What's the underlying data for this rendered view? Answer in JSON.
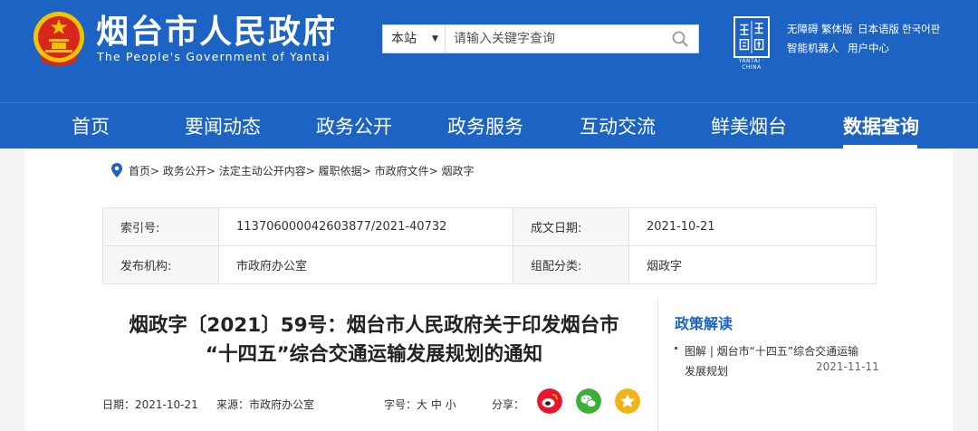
{
  "header": {
    "title": "烟台市人民政府",
    "subtitle": "The People's Government of Yantai",
    "seal_caption": "YANTAI · CHINA",
    "search": {
      "scope": "本站",
      "placeholder": "请输入关键字查询"
    },
    "utility_links": [
      "无障碍",
      "繁体版",
      "日本语版",
      "한국어판",
      "智能机器人",
      "用户中心"
    ]
  },
  "nav": {
    "items": [
      "首页",
      "要闻动态",
      "政务公开",
      "政务服务",
      "互动交流",
      "鲜美烟台",
      "数据查询"
    ],
    "active_index": 6
  },
  "breadcrumb": {
    "items": [
      "首页",
      "政务公开",
      "法定主动公开内容",
      "履职依据",
      "市政府文件",
      "烟政字"
    ],
    "separator": "> "
  },
  "meta": {
    "index_no_label": "索引号:",
    "index_no": "113706000042603877/2021-40732",
    "date_label": "成文日期:",
    "date": "2021-10-21",
    "publisher_label": "发布机构:",
    "publisher": "市政府办公室",
    "category_label": "组配分类:",
    "category": "烟政字"
  },
  "article": {
    "title_line1": "烟政字〔2021〕59号：烟台市人民政府关于印发烟台市",
    "title_line2": "“十四五”综合交通运输发展规划的通知",
    "date_label": "日期：",
    "date": "2021-10-21",
    "source_label": "来源：",
    "source": "市政府办公室",
    "fontsize_label": "字号：",
    "fontsize_options": [
      "大",
      "中",
      "小"
    ],
    "share_label": "分享："
  },
  "sidebar": {
    "title": "政策解读",
    "items": [
      {
        "line1": "图解 | 烟台市“十四五”综合交通运输",
        "line2": "发展规划",
        "date": "2021-11-11"
      }
    ]
  },
  "colors": {
    "brand_blue": "#1c63c4",
    "emblem_gold": "#f2c300",
    "emblem_red": "#d7261c",
    "weibo_red": "#e6162d",
    "wechat_green": "#3cb034",
    "favorite_gold": "#f2b318"
  },
  "icons": [
    "national-emblem-icon",
    "search-icon",
    "location-pin-icon",
    "weibo-icon",
    "wechat-icon",
    "favorite-star-icon"
  ]
}
